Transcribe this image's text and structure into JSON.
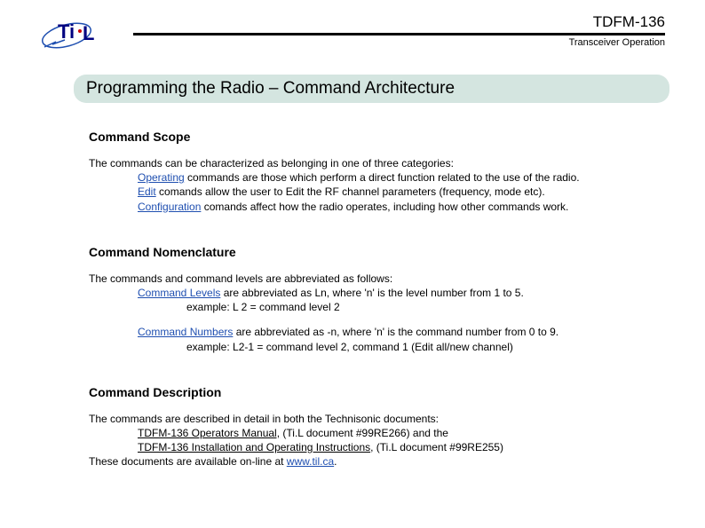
{
  "header": {
    "model": "TDFM-136",
    "subtitle": "Transceiver Operation"
  },
  "title": "Programming the Radio – Command Architecture",
  "sections": {
    "scope": {
      "heading": "Command Scope",
      "intro": "The commands can be characterized as belonging in one of three categories:",
      "items": [
        {
          "term": "Operating",
          "rest": " commands are those which perform a direct function related to the use of the radio."
        },
        {
          "term": "Edit",
          "rest": " comands allow the user to Edit the RF channel parameters (frequency, mode etc)."
        },
        {
          "term": "Configuration",
          "rest": " comands affect how the radio operates, including how other commands work."
        }
      ]
    },
    "nomenclature": {
      "heading": "Command Nomenclature",
      "intro": "The commands and command levels are abbreviated as follows:",
      "levels_term": "Command Levels",
      "levels_rest": " are abbreviated as Ln, where 'n' is the level number from 1 to 5.",
      "levels_example": "example: L 2 = command level 2",
      "numbers_term": "Command Numbers",
      "numbers_rest": " are abbreviated as -n, where 'n' is the command number from 0 to 9.",
      "numbers_example": "example: L2-1 = command level 2, command 1 (Edit  all/new channel)"
    },
    "description": {
      "heading": "Command Description",
      "intro": "The commands are described in detail in both the Technisonic documents:",
      "doc1_title": "TDFM-136 Operators Manual,",
      "doc1_rest": " (Ti.L document #99RE266) and the",
      "doc2_title": "TDFM-136 Installation and Operating Instructions",
      "doc2_rest": ", (Ti.L document #99RE255)",
      "online_pre": "These documents are available on-line at ",
      "online_link": "www.til.ca",
      "online_post": "."
    }
  }
}
